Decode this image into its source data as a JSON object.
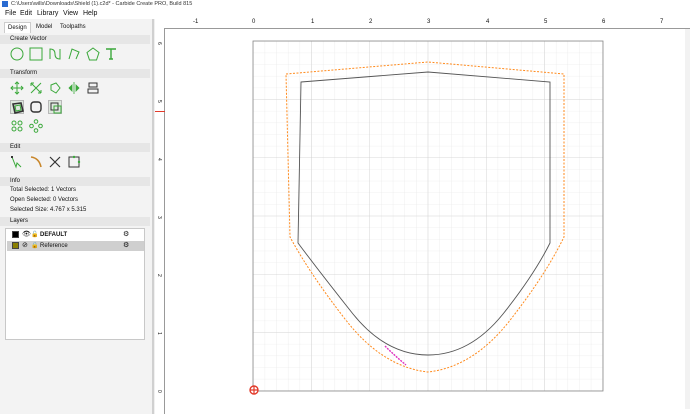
{
  "window": {
    "title": "C:\\Users\\wills\\Downloads\\Shield (1).c2d* - Carbide Create PRO, Build 815"
  },
  "menu": [
    "File",
    "Edit",
    "Library",
    "View",
    "Help"
  ],
  "tabs": [
    "Design",
    "Model",
    "Toolpaths"
  ],
  "sections": {
    "create_vector": "Create Vector",
    "transform": "Transform",
    "edit": "Edit",
    "info": "Info",
    "layers": "Layers"
  },
  "info": {
    "total_selected": "Total Selected:  1 Vectors",
    "open_selected": "Open Selected:  0 Vectors",
    "selected_size": "Selected Size:   4.767 x 5.315"
  },
  "layers": [
    {
      "name": "DEFAULT",
      "color": "#000000",
      "selected": false
    },
    {
      "name": "Reference",
      "color": "#8a7f00",
      "selected": true
    }
  ],
  "ruler_top": [
    "-1",
    "0",
    "1",
    "2",
    "3",
    "4",
    "5",
    "6",
    "7"
  ],
  "ruler_left": [
    "6",
    "5",
    "4",
    "3",
    "2",
    "1",
    "0"
  ],
  "colors": {
    "offset_path": "#ff8a1c",
    "shield_path": "#555555",
    "selection_segment": "#e030c0",
    "tool_green": "#3aa83a"
  }
}
